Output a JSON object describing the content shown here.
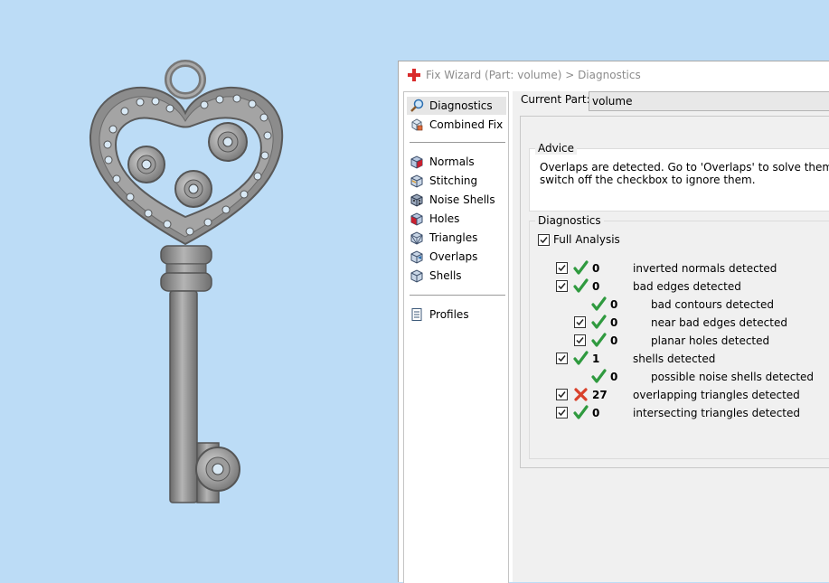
{
  "window": {
    "title": "Fix Wizard (Part: volume) > Diagnostics"
  },
  "nav": {
    "items": [
      {
        "label": "Diagnostics",
        "icon": "magnifier-icon",
        "selected": true
      },
      {
        "label": "Combined Fix",
        "icon": "combined-fix-icon"
      },
      {
        "label": "Normals",
        "icon": "normals-cube-icon"
      },
      {
        "label": "Stitching",
        "icon": "stitching-cube-icon"
      },
      {
        "label": "Noise Shells",
        "icon": "noise-shells-cube-icon"
      },
      {
        "label": "Holes",
        "icon": "holes-cube-icon"
      },
      {
        "label": "Triangles",
        "icon": "triangles-cube-icon"
      },
      {
        "label": "Overlaps",
        "icon": "overlaps-cube-icon"
      },
      {
        "label": "Shells",
        "icon": "shells-cube-icon"
      },
      {
        "label": "Profiles",
        "icon": "profiles-document-icon"
      }
    ]
  },
  "current_part": {
    "label": "Current Part:",
    "value": "volume"
  },
  "advice": {
    "title": "Advice",
    "line1": "Overlaps are detected. Go to 'Overlaps' to solve them. If they a",
    "line2": "switch off the checkbox to ignore them."
  },
  "diagnostics": {
    "title": "Diagnostics",
    "full_analysis_label": "Full Analysis",
    "full_analysis_checked": true,
    "rows": [
      {
        "checked": true,
        "status": "ok",
        "count": "0",
        "label": "inverted normals detected",
        "indent": 0
      },
      {
        "checked": true,
        "status": "ok",
        "count": "0",
        "label": "bad edges detected",
        "indent": 0
      },
      {
        "checked": null,
        "status": "ok",
        "count": "0",
        "label": "bad contours detected",
        "indent": 1
      },
      {
        "checked": true,
        "status": "ok",
        "count": "0",
        "label": "near bad edges detected",
        "indent": 1
      },
      {
        "checked": true,
        "status": "ok",
        "count": "0",
        "label": "planar holes detected",
        "indent": 1
      },
      {
        "checked": true,
        "status": "ok",
        "count": "1",
        "label": "shells detected",
        "indent": 0
      },
      {
        "checked": null,
        "status": "ok",
        "count": "0",
        "label": "possible noise shells detected",
        "indent": 1
      },
      {
        "checked": true,
        "status": "error",
        "count": "27",
        "label": "overlapping triangles detected",
        "indent": 0
      },
      {
        "checked": true,
        "status": "ok",
        "count": "0",
        "label": "intersecting triangles detected",
        "indent": 0
      }
    ]
  },
  "colors": {
    "viewport_background": "#bcdcf6",
    "ok_check": "#2f9a3f",
    "error_cross": "#d9412b",
    "app_icon_red": "#d92b2b"
  }
}
